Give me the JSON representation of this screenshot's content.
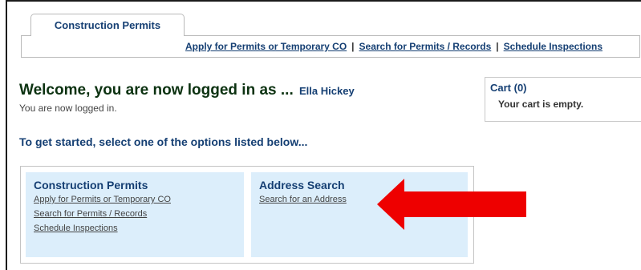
{
  "tab": {
    "label": "Construction Permits"
  },
  "nav": {
    "links": [
      "Apply for Permits or Temporary CO",
      "Search for Permits / Records",
      "Schedule Inspections"
    ],
    "separator": "|"
  },
  "welcome": {
    "heading": "Welcome, you are now logged in as ...",
    "user": "Ella Hickey",
    "status": "You are now logged in."
  },
  "instructions": "To get started, select one of the options listed below...",
  "cart": {
    "title": "Cart (0)",
    "empty_text": "Your cart is empty."
  },
  "options": {
    "construction": {
      "title": "Construction Permits",
      "links": [
        "Apply for Permits or Temporary CO",
        "Search for Permits / Records",
        "Schedule Inspections"
      ]
    },
    "address": {
      "title": "Address Search",
      "links": [
        "Search for an Address"
      ]
    }
  },
  "colors": {
    "link_blue": "#153f73",
    "heading_green": "#0c3211",
    "box_bg": "#dceefb",
    "arrow_red": "#ee0000"
  },
  "icons": {
    "arrow": "red-arrow-icon"
  }
}
